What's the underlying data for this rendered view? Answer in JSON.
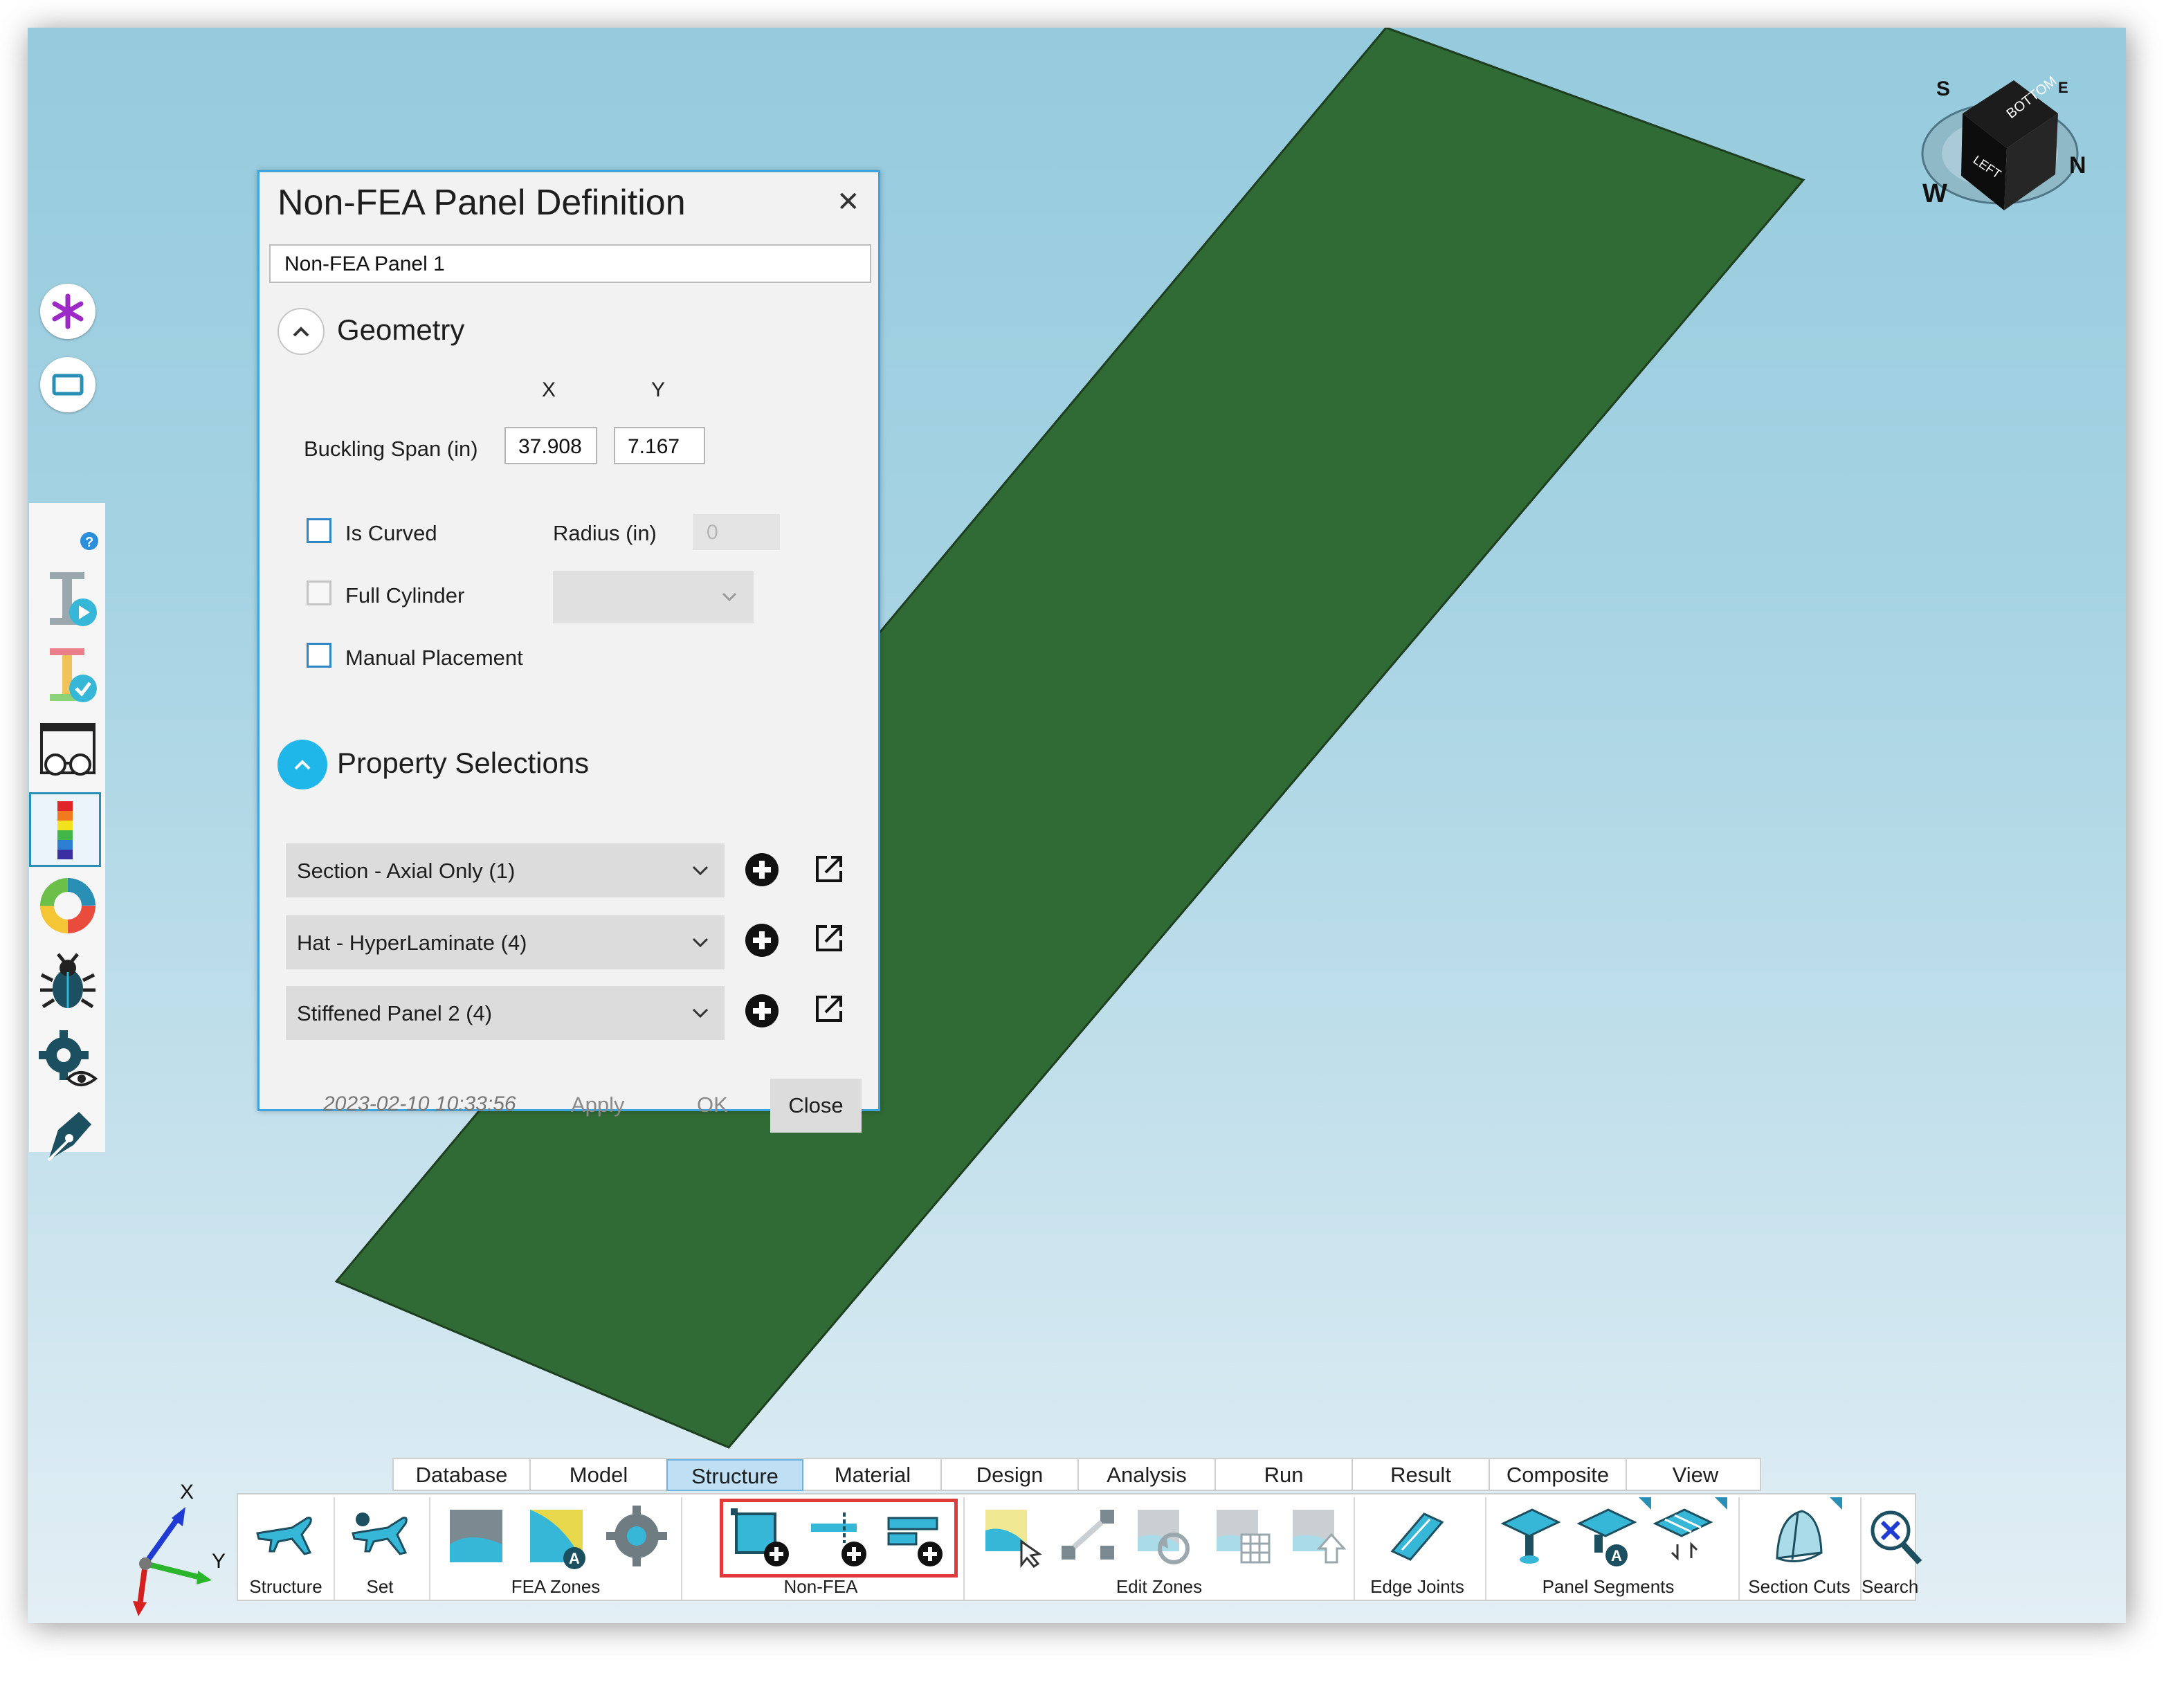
{
  "dialog": {
    "title": "Non-FEA Panel Definition",
    "close_glyph": "✕",
    "name_value": "Non-FEA Panel 1",
    "geometry": {
      "section_label": "Geometry",
      "x_header": "X",
      "y_header": "Y",
      "buckling_span_label": "Buckling Span (in)",
      "buckling_span_x": "37.908",
      "buckling_span_y": "7.167",
      "is_curved_label": "Is Curved",
      "is_curved_checked": false,
      "radius_label": "Radius (in)",
      "radius_value": "0",
      "full_cylinder_label": "Full Cylinder",
      "full_cylinder_checked": false,
      "manual_placement_label": "Manual Placement",
      "manual_placement_checked": false
    },
    "property_selections": {
      "section_label": "Property Selections",
      "combos": [
        "Section - Axial Only (1)",
        "Hat - HyperLaminate (4)",
        "Stiffened Panel 2 (4)"
      ]
    },
    "footer": {
      "timestamp": "2023-02-10 10:33:56",
      "apply_label": "Apply",
      "ok_label": "OK",
      "close_label": "Close"
    }
  },
  "ribbon": {
    "tabs": [
      "Database",
      "Model",
      "Structure",
      "Material",
      "Design",
      "Analysis",
      "Run",
      "Result",
      "Composite",
      "View"
    ],
    "active_tab": "Structure",
    "groups": {
      "structure": "Structure",
      "set": "Set",
      "fea_zones": "FEA Zones",
      "non_fea": "Non-FEA",
      "edit_zones": "Edit Zones",
      "edge_joints": "Edge Joints",
      "panel_segments": "Panel Segments",
      "section_cuts": "Section Cuts",
      "search": "Search"
    },
    "highlight_color": "#e03a3a"
  },
  "view_cube": {
    "face_top": "BOTTOM",
    "face_side": "LEFT",
    "compass": [
      "S",
      "E",
      "N",
      "W"
    ]
  },
  "axis_triad": {
    "x": "X",
    "y": "Y"
  },
  "colors": {
    "panel_fill": "#306b35",
    "dialog_border": "#3fa3dd",
    "accent": "#1fb6ea",
    "active_tab": "#bfe0f4"
  }
}
